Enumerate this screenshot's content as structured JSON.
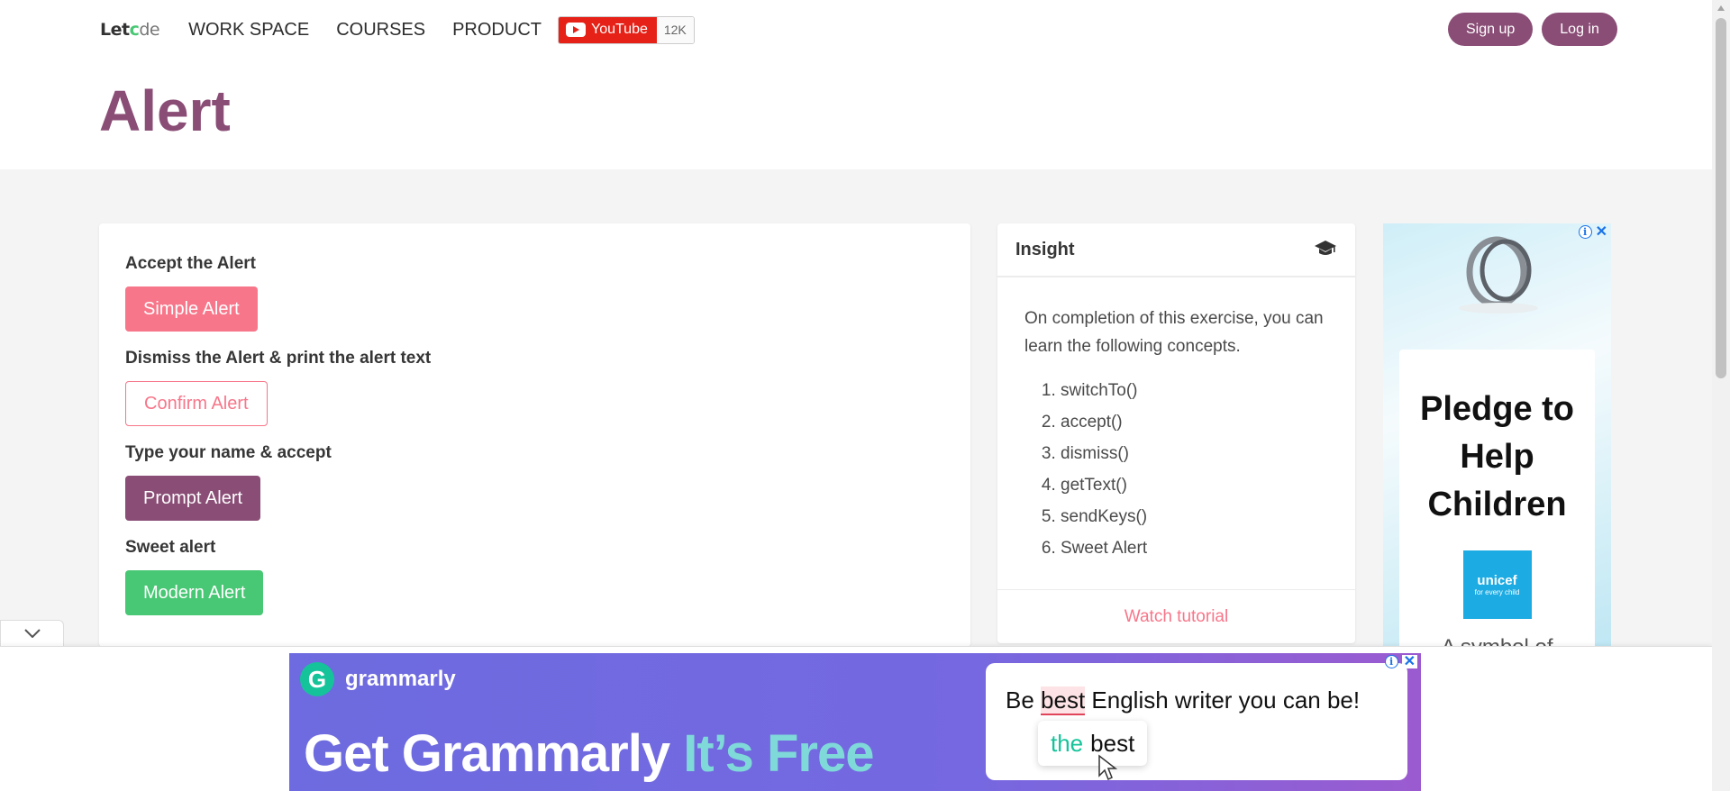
{
  "header": {
    "logo": {
      "bold": "Let",
      "accent": "c",
      "rest": "de",
      "full": "Letcode"
    },
    "nav": [
      "WORK SPACE",
      "COURSES",
      "PRODUCT"
    ],
    "youtube": {
      "label": "YouTube",
      "count": "12K"
    },
    "auth": {
      "signup": "Sign up",
      "login": "Log in"
    }
  },
  "page": {
    "title": "Alert"
  },
  "alerts": [
    {
      "label": "Accept the Alert",
      "button": "Simple Alert"
    },
    {
      "label": "Dismiss the Alert & print the alert text",
      "button": "Confirm Alert"
    },
    {
      "label": "Type your name & accept",
      "button": "Prompt Alert"
    },
    {
      "label": "Sweet alert",
      "button": "Modern Alert"
    }
  ],
  "insight": {
    "title": "Insight",
    "intro": "On completion of this exercise, you can learn the following concepts.",
    "concepts": [
      "switchTo()",
      "accept()",
      "dismiss()",
      "getText()",
      "sendKeys()",
      "Sweet Alert"
    ],
    "tutorial": "Watch tutorial"
  },
  "side_ad": {
    "headline": "Pledge to Help Children",
    "brand": "unicef",
    "brand_tag": "for every child",
    "partial_text": "A symbol of"
  },
  "bottom_ad": {
    "brand": "grammarly",
    "headline_main": "Get Grammarly",
    "headline_accent": "It’s Free",
    "sentence_pre": "Be ",
    "sentence_mark": "best",
    "sentence_post": " English writer you can be!",
    "suggestion_insert": "the",
    "suggestion_word": "best"
  },
  "colors": {
    "brand_purple": "#8a4d76",
    "danger": "#f7768a",
    "success": "#48c774",
    "youtube_red": "#e62117",
    "grammarly_green": "#15c39a"
  }
}
